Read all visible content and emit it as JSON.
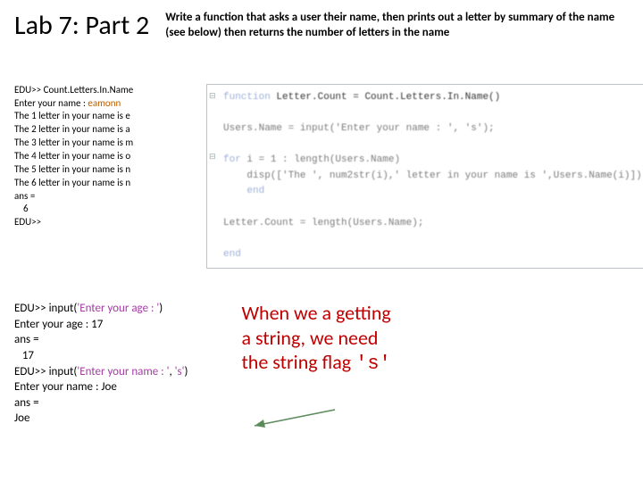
{
  "header": {
    "title": "Lab 7: Part 2",
    "instructions": "Write a function that asks a user their name, then prints out a letter by summary of the name (see below) then returns the number of letters in the name"
  },
  "console1": {
    "prompt1": "EDU>> Count.Letters.In.Name",
    "enter": "Enter your name : ",
    "name": "eamonn",
    "lines": [
      "The 1 letter in your name is e",
      "The 2 letter in your name is a",
      "The 3 letter in your name is m",
      "The 4 letter in your name is o",
      "The 5 letter in your name is n",
      "The 6 letter in your name is n"
    ],
    "ans": "ans =",
    "ansval": "    6",
    "prompt2": "EDU>>"
  },
  "code": {
    "l1": "function Letter.Count = Count.Letters.In.Name()",
    "l2": "Users.Name = input('Enter your name : ', 's');",
    "l3a": "for i = 1 : length(Users.Name)",
    "l4": "    disp(['The ', num2str(i),' letter in your name is ',Users.Name(i)])",
    "l5": "end",
    "l6": "Letter.Count = length(Users.Name);",
    "l7": "end"
  },
  "console2": {
    "l1": "EDU>> input('Enter your age : ')",
    "l1a": "'Enter your age : '",
    "l2": "Enter your age : 17",
    "l3": "ans =",
    "l4": "   17",
    "l5": "EDU>> input('Enter your name : ', 's')",
    "l5a": "'Enter your name : '",
    "l5b": ", ",
    "l5c": "'s'",
    "l6": "Enter your name : Joe",
    "l7": "ans =",
    "l8": "Joe"
  },
  "callout": {
    "t1": "When we a getting",
    "t2": "a string, we need",
    "t3": "the string flag ",
    "flag": "'s'"
  }
}
